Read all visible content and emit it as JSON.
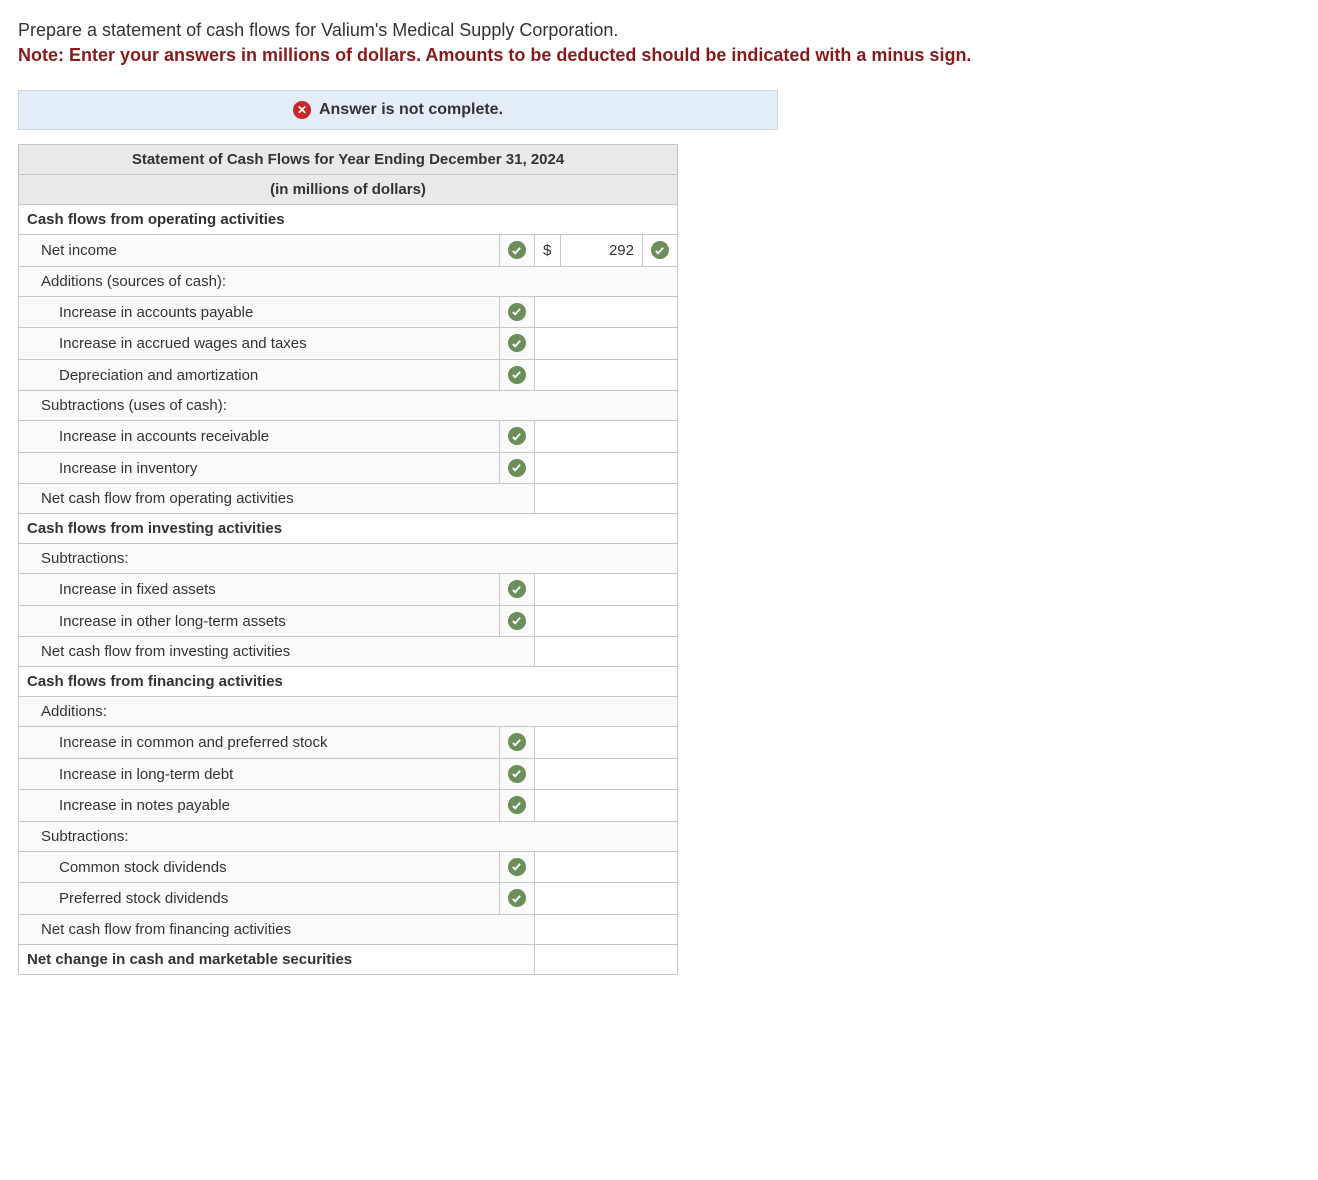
{
  "instructions": {
    "line1": "Prepare a statement of cash flows for Valium's Medical Supply Corporation.",
    "note": "Note: Enter your answers in millions of dollars. Amounts to be deducted should be indicated with a minus sign."
  },
  "banner": {
    "icon": "x-icon",
    "text": "Answer is not complete."
  },
  "statement": {
    "title": "Statement of Cash Flows for Year Ending December 31, 2024",
    "subtitle": "(in millions of dollars)"
  },
  "sections": {
    "operating": {
      "header": "Cash flows from operating activities",
      "netIncome": {
        "label": "Net income",
        "currency": "$",
        "value": "292"
      },
      "additionsHeader": "Additions (sources of cash):",
      "additions": [
        "Increase in accounts payable",
        "Increase in accrued wages and taxes",
        "Depreciation and amortization"
      ],
      "subtractionsHeader": "Subtractions (uses of cash):",
      "subtractions": [
        "Increase in accounts receivable",
        "Increase in inventory"
      ],
      "netLabel": "Net cash flow from operating activities"
    },
    "investing": {
      "header": "Cash flows from investing activities",
      "subtractionsHeader": "Subtractions:",
      "subtractions": [
        "Increase in fixed assets",
        "Increase in other long-term assets"
      ],
      "netLabel": "Net cash flow from investing activities"
    },
    "financing": {
      "header": "Cash flows from financing activities",
      "additionsHeader": "Additions:",
      "additions": [
        "Increase in common and preferred stock",
        "Increase in long-term debt",
        "Increase in notes payable"
      ],
      "subtractionsHeader": "Subtractions:",
      "subtractions": [
        "Common stock dividends",
        "Preferred stock dividends"
      ],
      "netLabel": "Net cash flow from financing activities"
    },
    "final": "Net change in cash and marketable securities"
  }
}
